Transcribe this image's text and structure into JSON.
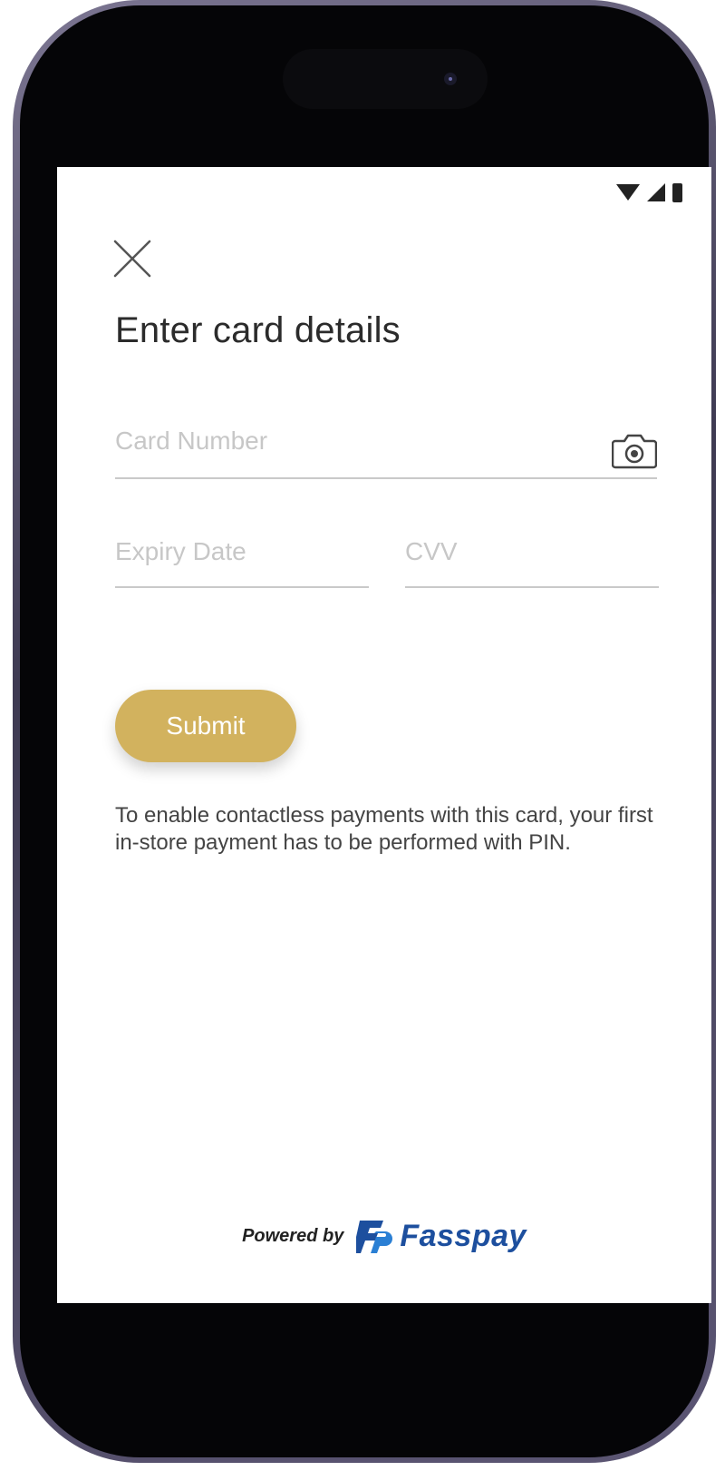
{
  "status_bar": {
    "icons": [
      "wifi-icon",
      "signal-icon",
      "battery-icon"
    ]
  },
  "header": {
    "close_icon": "close-icon",
    "title": "Enter card details"
  },
  "form": {
    "card_number": {
      "placeholder": "Card Number",
      "value": ""
    },
    "camera_icon": "camera-icon",
    "expiry_date": {
      "placeholder": "Expiry Date",
      "value": ""
    },
    "cvv": {
      "placeholder": "CVV",
      "value": ""
    },
    "submit_label": "Submit"
  },
  "info_text": "To enable contactless payments with this card, your first in-store payment has to be performed with PIN.",
  "footer": {
    "powered_by": "Powered by",
    "brand_name": "Fasspay"
  },
  "colors": {
    "accent": "#d2b25e",
    "brand": "#1d4f9e",
    "title_text": "#2b2b2b",
    "placeholder": "#c7c7c7",
    "field_line": "#c9c9c9"
  }
}
